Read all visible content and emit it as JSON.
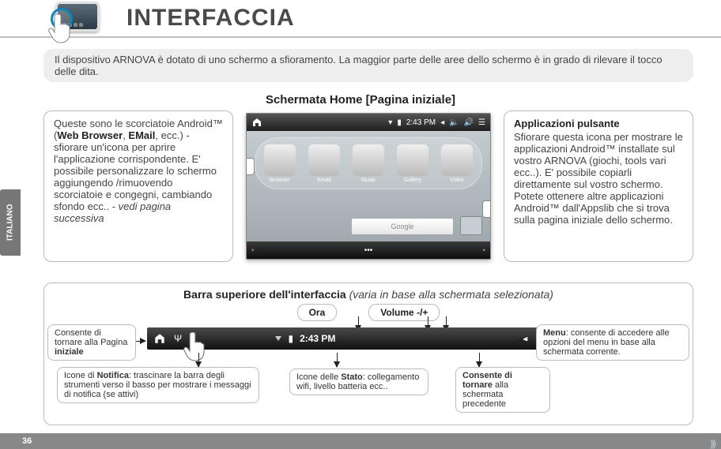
{
  "header": {
    "title": "INTERFACCIA"
  },
  "language_tab": "ITALIANO",
  "page_number": "36",
  "intro": "Il dispositivo ARNOVA è dotato di uno schermo a sfioramento. La maggior parte delle aree dello schermo è in grado di rilevare il tocco delle dita.",
  "home_title": "Schermata Home [Pagina iniziale]",
  "left_box": {
    "line1a": "Queste sono le scorciatoie Android™ (",
    "bold1": "Web Browser",
    "sep": ", ",
    "bold2": "EMail",
    "line1b": ", ecc.) - sfiorare un'icona per aprire l'applicazione corrispondente. E' possibile personalizzare lo schermo aggiungendo /rimuovendo scorciatoie e congegni, cambiando sfondo ecc.. - ",
    "italic": "vedi pagina successiva"
  },
  "right_box": {
    "title": "Applicazioni pulsante",
    "body": "Sfiorare questa icona per mostrare le applicazioni Android™ installate sul vostro ARNOVA (giochi, tools vari ecc..). E' possibile copiarli direttamente sul vostro schermo. Potete ottenere altre applicazioni Android™ dall'Appslib che si trova sulla pagina iniziale dello schermo."
  },
  "screenshot": {
    "time": "2:43 PM",
    "apps": [
      "Browser",
      "Email",
      "Music",
      "Gallery",
      "Video"
    ],
    "search": "Google"
  },
  "lower": {
    "title_bold": "Barra superiore dell'interfaccia",
    "title_italic": " (varia in base alla schermata selezionata)",
    "pill_time": "Ora",
    "pill_volume": "Volume -/+",
    "bar_time": "2:43 PM",
    "note_home_a": "Consente di tornare alla Pagina ",
    "note_home_b": "iniziale",
    "note_menu_a": "Menu",
    "note_menu_b": ": consente di accedere alle opzioni del menu in base alla schermata corrente.",
    "note_notif_a": "Icone di ",
    "note_notif_b": "Notifica",
    "note_notif_c": ": trascinare la barra degli strumenti verso il basso per mostrare i messaggi di notifica (se attivi)",
    "note_status_a": "Icone delle ",
    "note_status_b": "Stato",
    "note_status_c": ": collegamento wifi, livello batteria ecc..",
    "note_back_a": "Consente di tornare",
    "note_back_b": " alla schermata precedente"
  }
}
